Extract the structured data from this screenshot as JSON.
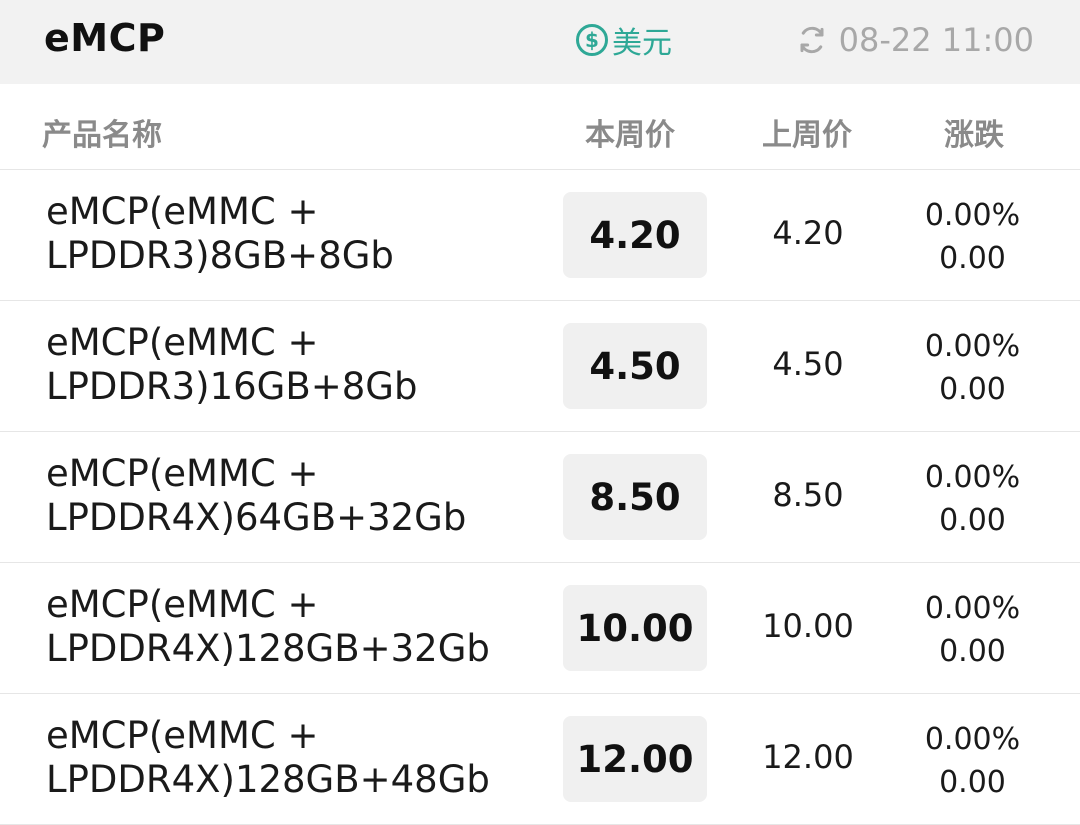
{
  "header": {
    "title": "eMCP",
    "currency_icon": "dollar-coin-icon",
    "currency_label": "美元",
    "refresh_icon": "refresh-icon",
    "update_time": "08-22 11:00"
  },
  "columns": {
    "name": "产品名称",
    "this_week": "本周价",
    "last_week": "上周价",
    "change": "涨跌"
  },
  "colors": {
    "accent": "#2ea896",
    "muted": "#a8a8a8",
    "topbar_bg": "#f2f2f2",
    "price_box_bg": "#f0f0f0"
  },
  "rows": [
    {
      "name_line1": "eMCP(eMMC +",
      "name_line2": "LPDDR3)8GB+8Gb",
      "this_week": "4.20",
      "last_week": "4.20",
      "change_pct": "0.00%",
      "change_abs": "0.00"
    },
    {
      "name_line1": "eMCP(eMMC +",
      "name_line2": "LPDDR3)16GB+8Gb",
      "this_week": "4.50",
      "last_week": "4.50",
      "change_pct": "0.00%",
      "change_abs": "0.00"
    },
    {
      "name_line1": "eMCP(eMMC +",
      "name_line2": "LPDDR4X)64GB+32Gb",
      "this_week": "8.50",
      "last_week": "8.50",
      "change_pct": "0.00%",
      "change_abs": "0.00"
    },
    {
      "name_line1": "eMCP(eMMC +",
      "name_line2": "LPDDR4X)128GB+32Gb",
      "this_week": "10.00",
      "last_week": "10.00",
      "change_pct": "0.00%",
      "change_abs": "0.00"
    },
    {
      "name_line1": "eMCP(eMMC +",
      "name_line2": "LPDDR4X)128GB+48Gb",
      "this_week": "12.00",
      "last_week": "12.00",
      "change_pct": "0.00%",
      "change_abs": "0.00"
    }
  ]
}
